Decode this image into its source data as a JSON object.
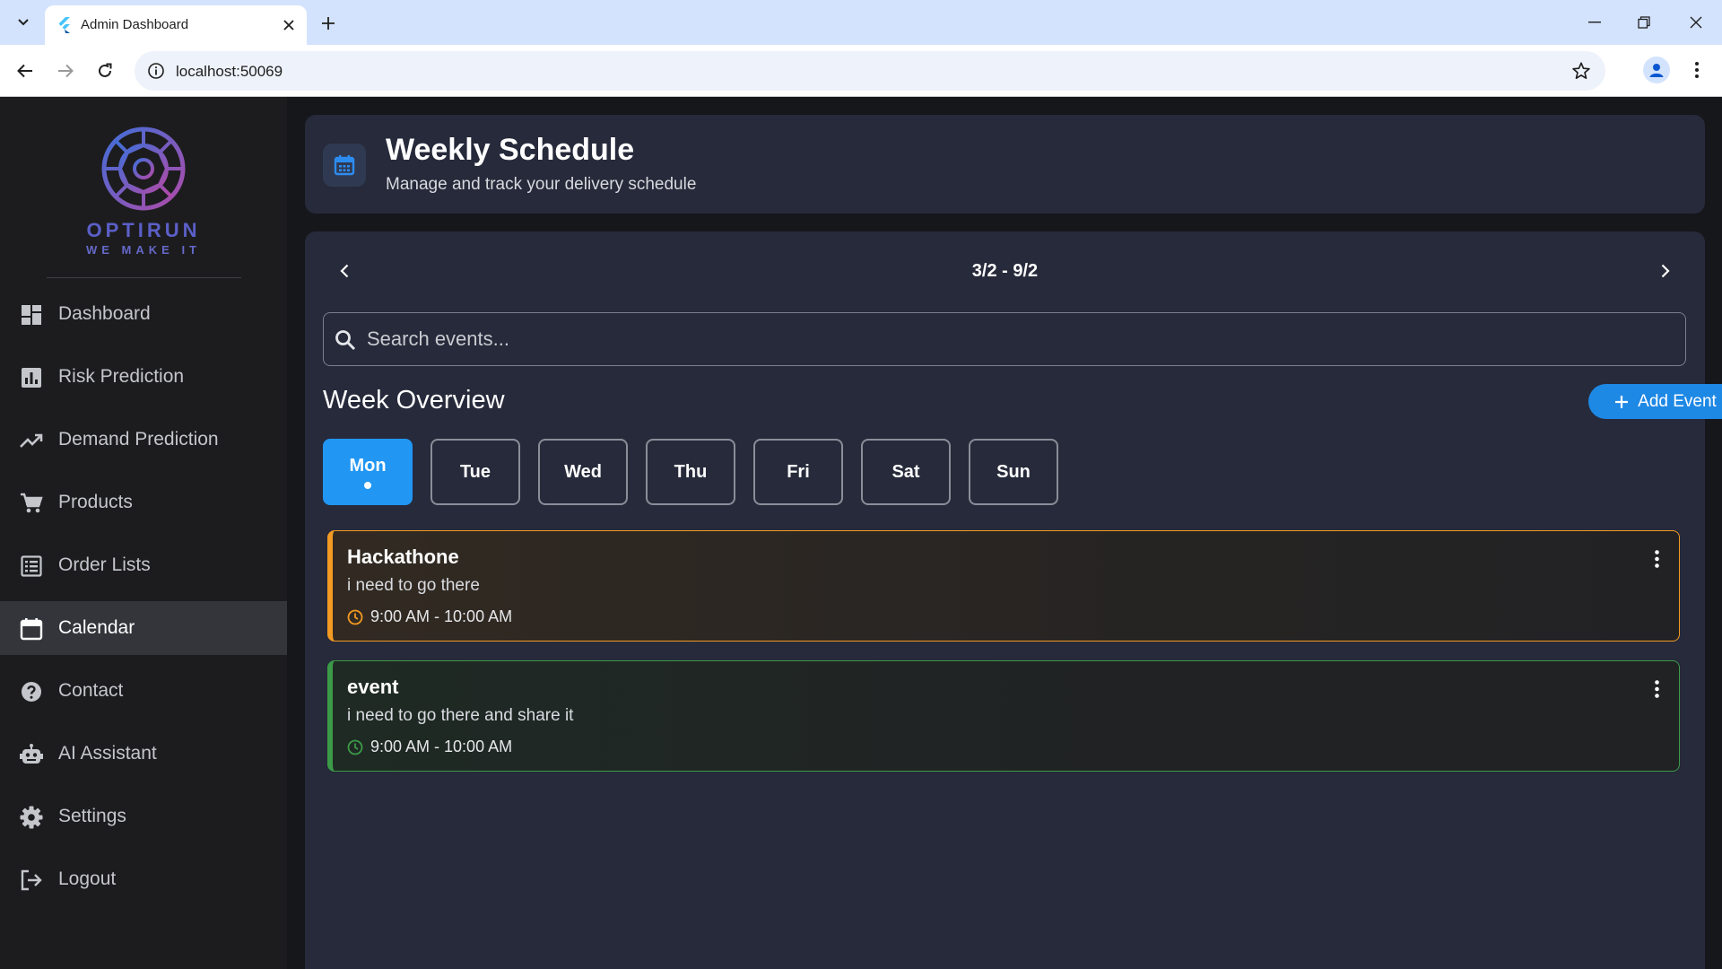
{
  "browser": {
    "tab_title": "Admin Dashboard",
    "url": "localhost:50069",
    "icons": [
      "tab-search-icon",
      "flutter-icon",
      "close-icon",
      "plus-icon",
      "minimize-icon",
      "restore-icon",
      "window-close-icon",
      "back-icon",
      "forward-icon",
      "reload-icon",
      "info-icon",
      "star-icon",
      "profile-icon",
      "menu-dots-icon"
    ]
  },
  "brand": {
    "name": "OPTIRUN",
    "tagline": "WE MAKE IT",
    "color": "#5b5fc7"
  },
  "sidebar": {
    "items": [
      {
        "label": "Dashboard",
        "icon": "dashboard-icon"
      },
      {
        "label": "Risk Prediction",
        "icon": "bar-chart-icon"
      },
      {
        "label": "Demand Prediction",
        "icon": "trending-up-icon"
      },
      {
        "label": "Products",
        "icon": "cart-icon"
      },
      {
        "label": "Order Lists",
        "icon": "list-icon"
      },
      {
        "label": "Calendar",
        "icon": "calendar-icon",
        "active": true
      },
      {
        "label": "Contact",
        "icon": "help-icon"
      },
      {
        "label": "AI Assistant",
        "icon": "robot-icon"
      },
      {
        "label": "Settings",
        "icon": "gear-icon"
      },
      {
        "label": "Logout",
        "icon": "logout-icon"
      }
    ]
  },
  "header": {
    "title": "Weekly Schedule",
    "subtitle": "Manage and track your delivery schedule",
    "icon": "calendar-icon"
  },
  "week": {
    "range": "3/2 - 9/2"
  },
  "search": {
    "placeholder": "Search events...",
    "value": ""
  },
  "overview": {
    "title": "Week Overview",
    "add_label": "Add Event"
  },
  "days": [
    {
      "label": "Mon",
      "selected": true,
      "has_events": true
    },
    {
      "label": "Tue"
    },
    {
      "label": "Wed"
    },
    {
      "label": "Thu"
    },
    {
      "label": "Fri"
    },
    {
      "label": "Sat"
    },
    {
      "label": "Sun"
    }
  ],
  "events": [
    {
      "title": "Hackathone",
      "description": "i need to go there",
      "time": "9:00 AM - 10:00 AM",
      "color": "#f29a22"
    },
    {
      "title": "event",
      "description": "i need to go there and share it",
      "time": "9:00 AM - 10:00 AM",
      "color": "#3c9a47"
    }
  ],
  "colors": {
    "accent": "#2196f3",
    "sidebar_bg": "#1c1c1e",
    "card_bg": "#262a3a"
  }
}
